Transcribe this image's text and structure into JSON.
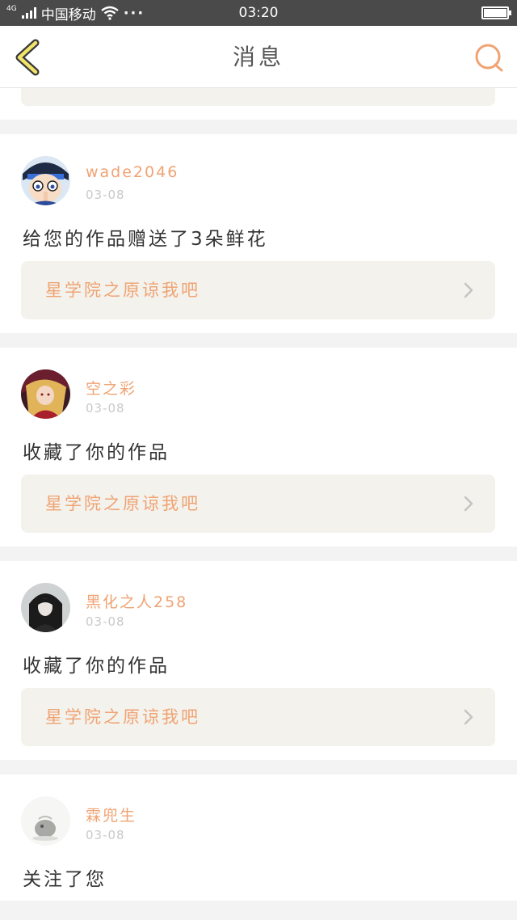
{
  "status_bar": {
    "network": "4G",
    "carrier": "中国移动",
    "more": "···",
    "time": "03:20"
  },
  "header": {
    "title": "消息",
    "accent_color": "#f0a373"
  },
  "messages": [
    {
      "username": "wade2046",
      "date": "03-08",
      "action": "给您的作品赠送了3朵鲜花",
      "work_title": "星学院之原谅我吧"
    },
    {
      "username": "空之彩",
      "date": "03-08",
      "action": "收藏了你的作品",
      "work_title": "星学院之原谅我吧"
    },
    {
      "username": "黑化之人258",
      "date": "03-08",
      "action": "收藏了你的作品",
      "work_title": "星学院之原谅我吧"
    },
    {
      "username": "霖兜生",
      "date": "03-08",
      "action": "关注了您"
    }
  ]
}
